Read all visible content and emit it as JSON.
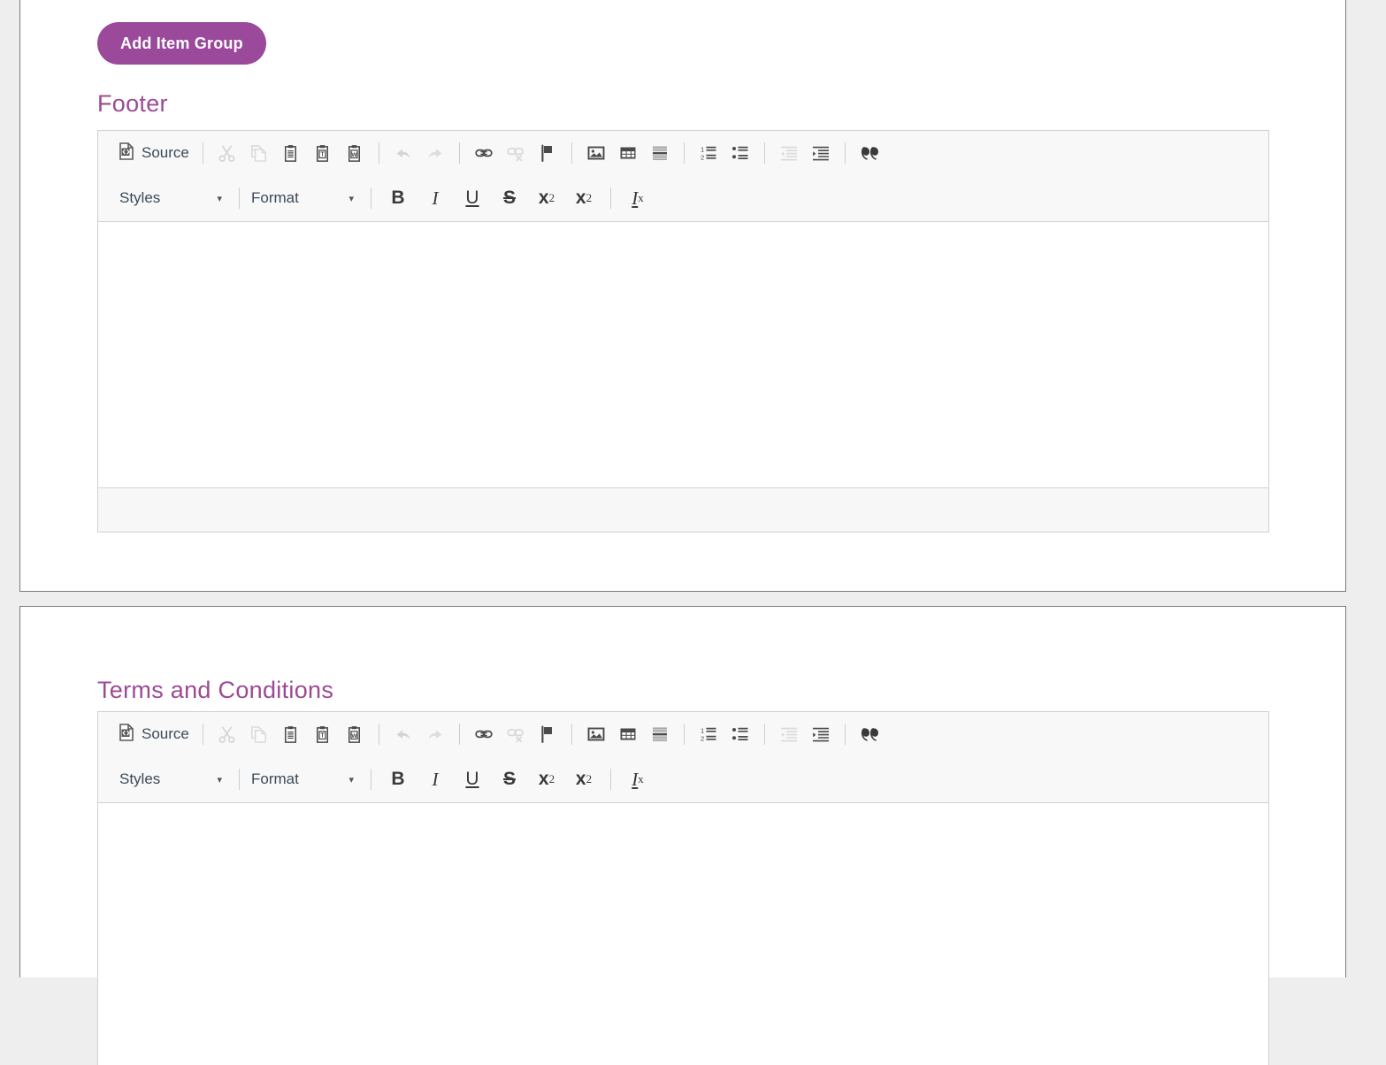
{
  "page": {
    "background": "#eeeeee",
    "accent_purple": "#9b4a9b",
    "heading_purple": "#9c4a93"
  },
  "toolbar_button": {
    "add_item_group_label": "Add Item Group"
  },
  "sections": [
    {
      "id": "footer",
      "title": "Footer"
    },
    {
      "id": "terms",
      "title": "Terms and Conditions"
    }
  ],
  "editor": {
    "source_label": "Source",
    "styles_label": "Styles",
    "format_label": "Format",
    "caret_glyph": "▾",
    "row1_tools": [
      {
        "name": "source",
        "label": "Source",
        "enabled": true
      },
      {
        "name": "cut",
        "label": "Cut",
        "enabled": false
      },
      {
        "name": "copy",
        "label": "Copy",
        "enabled": false
      },
      {
        "name": "paste",
        "label": "Paste",
        "enabled": true
      },
      {
        "name": "paste-text",
        "label": "Paste as plain text",
        "enabled": true
      },
      {
        "name": "paste-word",
        "label": "Paste from Word",
        "enabled": true
      },
      {
        "name": "undo",
        "label": "Undo",
        "enabled": false
      },
      {
        "name": "redo",
        "label": "Redo",
        "enabled": false
      },
      {
        "name": "link",
        "label": "Link",
        "enabled": true
      },
      {
        "name": "unlink",
        "label": "Unlink",
        "enabled": false
      },
      {
        "name": "anchor",
        "label": "Anchor",
        "enabled": true
      },
      {
        "name": "image",
        "label": "Image",
        "enabled": true
      },
      {
        "name": "table",
        "label": "Table",
        "enabled": true
      },
      {
        "name": "horizontal-rule",
        "label": "Horizontal Line",
        "enabled": true
      },
      {
        "name": "numbered-list",
        "label": "Insert/Remove Numbered List",
        "enabled": true
      },
      {
        "name": "bulleted-list",
        "label": "Insert/Remove Bulleted List",
        "enabled": true
      },
      {
        "name": "outdent",
        "label": "Decrease Indent",
        "enabled": false
      },
      {
        "name": "indent",
        "label": "Increase Indent",
        "enabled": true
      },
      {
        "name": "blockquote",
        "label": "Block Quote",
        "enabled": true
      }
    ],
    "row2_tools": [
      {
        "name": "bold",
        "label": "B",
        "enabled": true
      },
      {
        "name": "italic",
        "label": "I",
        "enabled": true
      },
      {
        "name": "underline",
        "label": "U",
        "enabled": true
      },
      {
        "name": "strikethrough",
        "label": "S",
        "enabled": true
      },
      {
        "name": "subscript",
        "label": "x",
        "affix": "2",
        "enabled": true
      },
      {
        "name": "superscript",
        "label": "x",
        "affix": "2",
        "enabled": true
      },
      {
        "name": "remove-format",
        "label": "I",
        "affix": "x",
        "enabled": true
      }
    ],
    "content_footer": {
      "body_text": "",
      "element_path": ""
    }
  }
}
